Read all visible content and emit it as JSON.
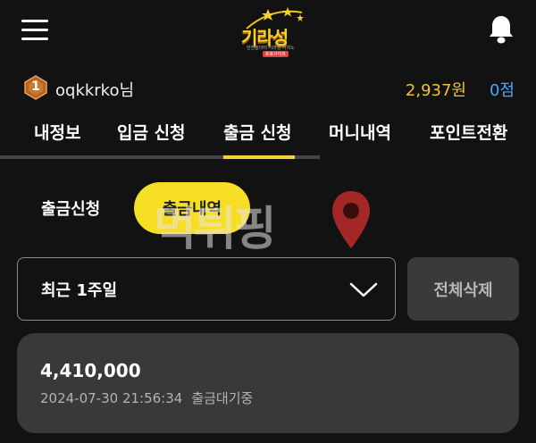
{
  "header": {
    "logo_text": "기라성",
    "logo_sub": "안전놀이터 기라성 카지노",
    "logo_badge": "토토사이트"
  },
  "user": {
    "name": "oqkkrko님",
    "rank_number": "1",
    "balance": "2,937원",
    "points": "0점"
  },
  "tabs": [
    {
      "label": "내정보"
    },
    {
      "label": "입금 신청"
    },
    {
      "label": "출금 신청",
      "active": true
    },
    {
      "label": "머니내역"
    },
    {
      "label": "포인트전환"
    }
  ],
  "subtabs": {
    "request_label": "출금신청",
    "history_label": "출금내역"
  },
  "watermark": {
    "text": "먹튀핑"
  },
  "filter": {
    "selected": "최근 1주일",
    "delete_label": "전체삭제"
  },
  "records": [
    {
      "amount": "4,410,000",
      "datetime": "2024-07-30 21:56:34",
      "status": "출금대기중"
    }
  ],
  "colors": {
    "background": "#121212",
    "accent_yellow": "#f6de24",
    "balance": "#f2c230",
    "points": "#4aa8ff",
    "card": "#39393b"
  }
}
